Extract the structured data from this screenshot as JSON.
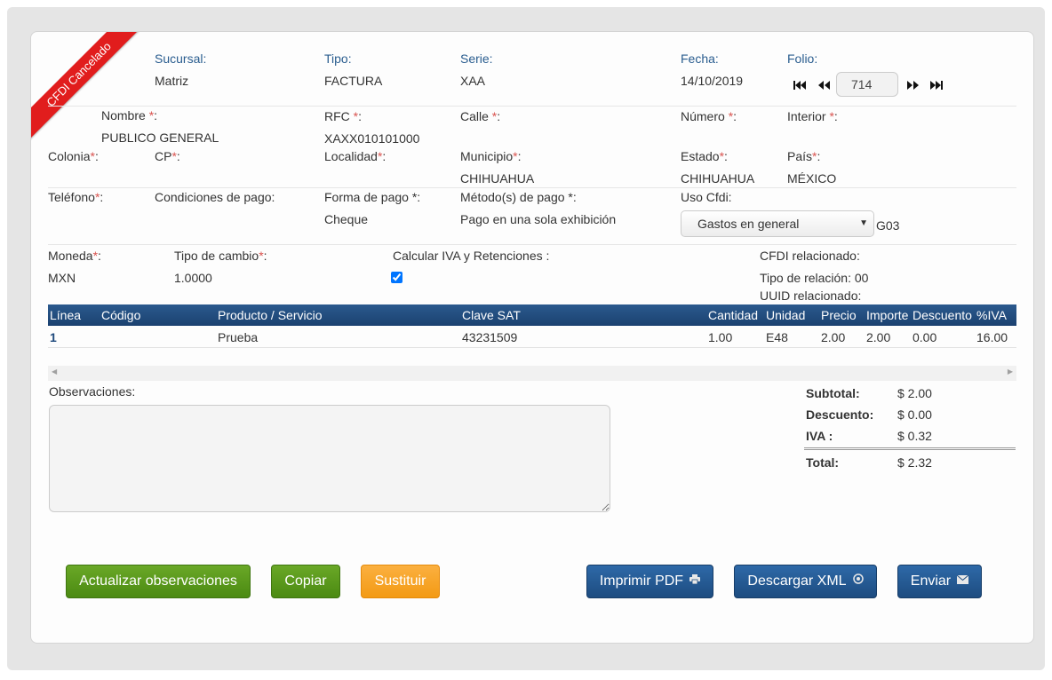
{
  "status_ribbon": "CFDI Cancelado",
  "header": {
    "sucursal": {
      "label": "Sucursal:",
      "value": "Matriz"
    },
    "tipo": {
      "label": "Tipo:",
      "value": "FACTURA"
    },
    "serie": {
      "label": "Serie:",
      "value": "XAA"
    },
    "fecha": {
      "label": "Fecha:",
      "value": "14/10/2019"
    },
    "folio": {
      "label": "Folio:",
      "value": "714"
    }
  },
  "required_mark": "*",
  "customer": {
    "nombre": {
      "label": "Nombre ",
      "value": "PUBLICO GENERAL"
    },
    "rfc": {
      "label": "RFC ",
      "value": "XAXX010101000"
    },
    "calle": {
      "label": "Calle ",
      "value": ""
    },
    "numero": {
      "label": "Número ",
      "value": ""
    },
    "interior": {
      "label": "Interior ",
      "value": ""
    },
    "colonia": {
      "label": "Colonia",
      "value": ""
    },
    "cp": {
      "label": "CP",
      "value": ""
    },
    "localidad": {
      "label": "Localidad",
      "value": ""
    },
    "municipio": {
      "label": "Municipio",
      "value": "CHIHUAHUA"
    },
    "estado": {
      "label": "Estado",
      "value": "CHIHUAHUA"
    },
    "pais": {
      "label": "País",
      "value": "MÉXICO"
    },
    "suffix_colon": ":"
  },
  "payment": {
    "telefono": {
      "label": "Teléfono",
      "value": ""
    },
    "condiciones": {
      "label": "Condiciones de pago:",
      "value": ""
    },
    "forma_pago": {
      "label": "Forma de pago *:",
      "value": "Cheque"
    },
    "metodo_pago": {
      "label": "Método(s) de pago *:",
      "value": "Pago en una sola exhibición"
    },
    "uso_cfdi": {
      "label": "Uso Cfdi:",
      "selected": "Gastos en general",
      "code": "G03"
    }
  },
  "currency": {
    "moneda": {
      "label": "Moneda",
      "value": "MXN"
    },
    "tipo_cambio": {
      "label": "Tipo de cambio",
      "value": "1.0000"
    },
    "calcular_iva": {
      "label": "Calcular IVA y Retenciones :",
      "checked": true
    },
    "cfdi_relacionado": "CFDI relacionado:",
    "tipo_relacion": "Tipo de relación: 00",
    "uuid_relacionado": "UUID relacionado:"
  },
  "table": {
    "columns": [
      "Línea",
      "Código",
      "Producto / Servicio",
      "Clave SAT",
      "Cantidad",
      "Unidad",
      "Precio",
      "Importe",
      "Descuento",
      "%IVA"
    ],
    "rows": [
      {
        "linea": "1",
        "codigo": "",
        "producto": "Prueba",
        "clave_sat": "43231509",
        "cantidad": "1.00",
        "unidad": "E48",
        "precio": "2.00",
        "importe": "2.00",
        "descuento": "0.00",
        "iva": "16.00"
      }
    ]
  },
  "observaciones": {
    "label": "Observaciones:",
    "value": ""
  },
  "totals": {
    "subtotal": {
      "label": "Subtotal:",
      "value": "$ 2.00"
    },
    "descuento": {
      "label": "Descuento:",
      "value": "$ 0.00"
    },
    "iva": {
      "label": "IVA :",
      "value": "$ 0.32"
    },
    "total": {
      "label": "Total:",
      "value": "$ 2.32"
    }
  },
  "buttons": {
    "actualizar": "Actualizar observaciones",
    "copiar": "Copiar",
    "sustituir": "Sustituir",
    "imprimir_pdf": "Imprimir PDF",
    "descargar_xml": "Descargar XML",
    "enviar": "Enviar"
  },
  "icons": {
    "first": "first-page-icon",
    "prev": "prev-page-icon",
    "next": "next-page-icon",
    "last": "last-page-icon",
    "print": "print-icon",
    "download": "download-icon",
    "mail": "mail-icon"
  },
  "colors": {
    "ribbon": "#e11d1d",
    "label_blue": "#2a5d8f",
    "table_header": "#1f4a7d",
    "green": "#5a9a1c",
    "orange": "#f7a52a",
    "blue": "#235b97"
  }
}
